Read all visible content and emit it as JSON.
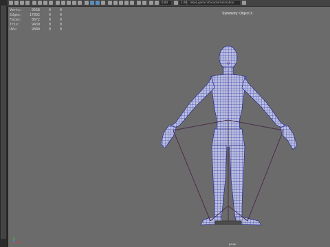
{
  "viewport": {
    "panel_dropdown": "rebel_game:characterAnimation",
    "field_a": "0.00",
    "field_b": "1.00",
    "symmetry_label": "Symmetry: Object X",
    "camera_label": "persp"
  },
  "hud": {
    "rows": [
      {
        "label": "Verts:",
        "v1": "9568",
        "v2": "0",
        "v3": "0"
      },
      {
        "label": "Edges:",
        "v1": "17892",
        "v2": "0",
        "v3": "0"
      },
      {
        "label": "Faces:",
        "v1": "8672",
        "v2": "0",
        "v3": "0"
      },
      {
        "label": "Tris:",
        "v1": "9430",
        "v2": "0",
        "v3": "0"
      },
      {
        "label": "UVs:",
        "v1": "9880",
        "v2": "0",
        "v3": "0"
      }
    ]
  },
  "colors": {
    "viewport_bg": "#6b6b6b",
    "wireframe": "#3f3fae",
    "skin": "#b8bede",
    "joint": "#5a3a5a"
  }
}
